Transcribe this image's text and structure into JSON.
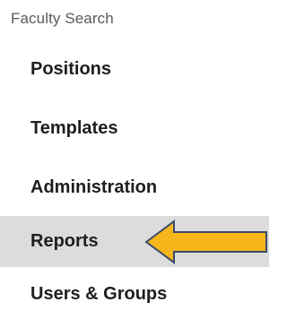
{
  "sidebar": {
    "section_title": "Faculty Search",
    "items": [
      {
        "label": "Positions",
        "active": false
      },
      {
        "label": "Templates",
        "active": false
      },
      {
        "label": "Administration",
        "active": false
      },
      {
        "label": "Reports",
        "active": true
      },
      {
        "label": "Users & Groups",
        "active": false
      }
    ]
  },
  "annotation": {
    "icon": "left-arrow-callout-icon",
    "fill_color": "#F5B51B",
    "stroke_color": "#3A4A6B"
  },
  "colors": {
    "active_background": "#DCDCDC",
    "item_text": "#1E1E1E",
    "section_title_text": "#5A5A5A"
  }
}
